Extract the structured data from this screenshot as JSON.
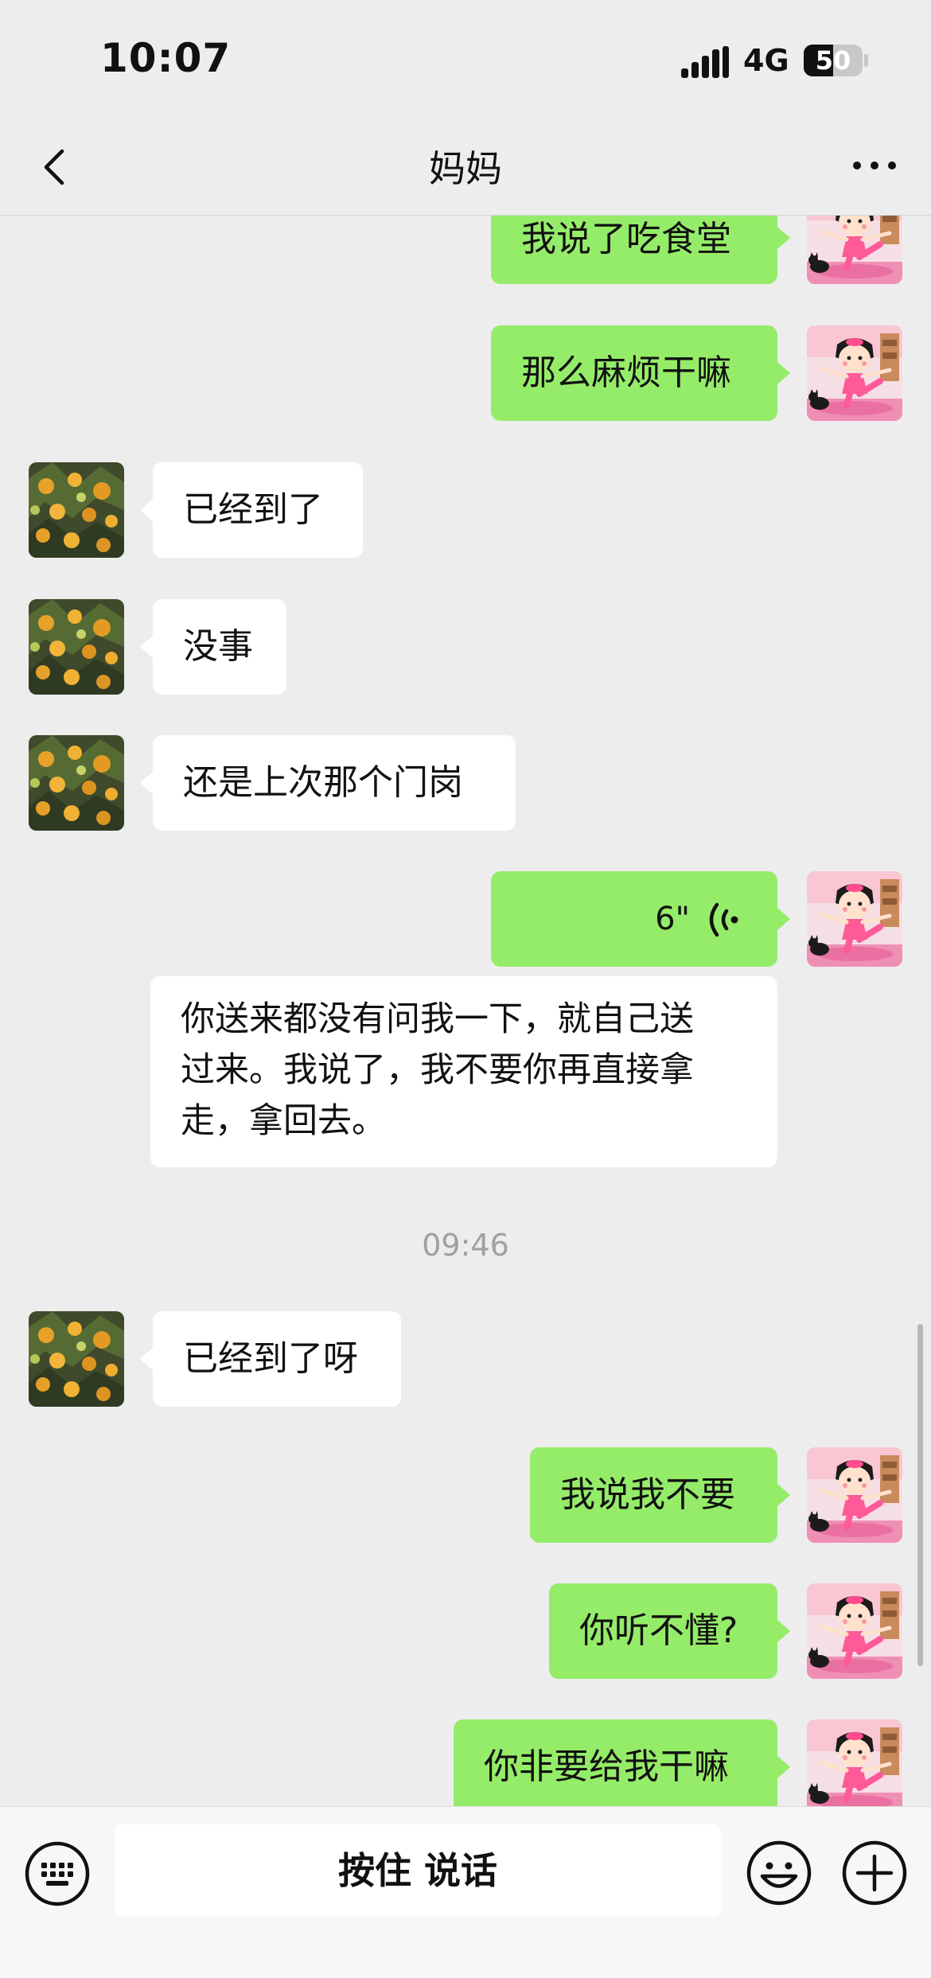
{
  "status_bar": {
    "time": "10:07",
    "network": "4G",
    "battery": "50"
  },
  "header": {
    "title": "妈妈",
    "back_icon": "chevron-left-icon",
    "more_icon": "more-dots-icon"
  },
  "messages": [
    {
      "side": "out",
      "type": "text",
      "text": "我说了吃食堂"
    },
    {
      "side": "out",
      "type": "text",
      "text": "那么麻烦干嘛"
    },
    {
      "side": "in",
      "type": "text",
      "text": "已经到了"
    },
    {
      "side": "in",
      "type": "text",
      "text": "没事"
    },
    {
      "side": "in",
      "type": "text",
      "text": "还是上次那个门岗"
    },
    {
      "side": "out",
      "type": "voice",
      "duration": "6\""
    },
    {
      "side": "transcript",
      "type": "text",
      "lines": [
        "你送来都没有问我一下，就自己送",
        "过来。我说了，我不要你再直接拿",
        "走，拿回去。"
      ]
    },
    {
      "side": "in",
      "type": "text",
      "text": "已经到了呀"
    },
    {
      "side": "out",
      "type": "text",
      "text": "我说我不要"
    },
    {
      "side": "out",
      "type": "text",
      "text": "你听不懂?"
    },
    {
      "side": "out",
      "type": "text",
      "text": "你非要给我干嘛"
    }
  ],
  "timestamp": "09:46",
  "input_bar": {
    "hold_to_talk": "按住 说话",
    "keyboard_icon": "keyboard-icon",
    "emoji_icon": "emoji-icon",
    "plus_icon": "plus-icon"
  },
  "colors": {
    "outgoing_bubble": "#95ec69",
    "incoming_bubble": "#ffffff",
    "background": "#ededed"
  }
}
